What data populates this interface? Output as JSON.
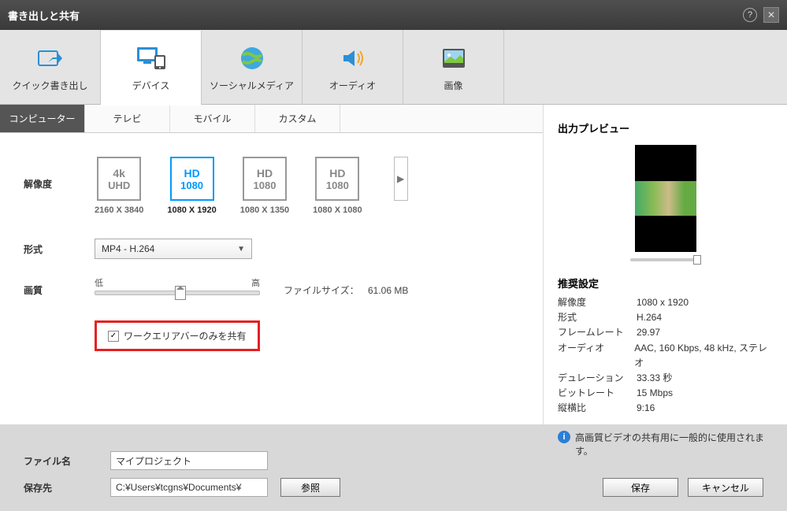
{
  "window": {
    "title": "書き出しと共有"
  },
  "mainTabs": [
    {
      "label": "クイック書き出し"
    },
    {
      "label": "デバイス"
    },
    {
      "label": "ソーシャルメディア"
    },
    {
      "label": "オーディオ"
    },
    {
      "label": "画像"
    }
  ],
  "subTabs": [
    {
      "label": "コンピューター"
    },
    {
      "label": "テレビ"
    },
    {
      "label": "モバイル"
    },
    {
      "label": "カスタム"
    }
  ],
  "labels": {
    "resolution": "解像度",
    "format": "形式",
    "quality": "画質",
    "qualityLow": "低",
    "qualityHigh": "高",
    "filesize": "ファイルサイズ：",
    "checkbox": "ワークエリアバーのみを共有",
    "filename": "ファイル名",
    "savedest": "保存先",
    "browse": "参照",
    "save": "保存",
    "cancel": "キャンセル"
  },
  "resolutions": [
    {
      "top": "4k",
      "bottom": "UHD",
      "caption": "2160 X 3840"
    },
    {
      "top": "HD",
      "bottom": "1080",
      "caption": "1080 X 1920"
    },
    {
      "top": "HD",
      "bottom": "1080",
      "caption": "1080 X 1350"
    },
    {
      "top": "HD",
      "bottom": "1080",
      "caption": "1080 X 1080"
    }
  ],
  "formatValue": "MP4 - H.264",
  "filesizeValue": "61.06 MB",
  "checkboxChecked": true,
  "preview": {
    "title": "出力プレビュー",
    "recTitle": "推奨設定",
    "rows": [
      {
        "k": "解像度",
        "v": "1080 x 1920"
      },
      {
        "k": "形式",
        "v": "H.264"
      },
      {
        "k": "フレームレート",
        "v": "29.97"
      },
      {
        "k": "オーディオ",
        "v": "AAC, 160 Kbps, 48 kHz, ステレオ"
      },
      {
        "k": "デュレーション",
        "v": "33.33 秒"
      },
      {
        "k": "ビットレート",
        "v": "15 Mbps"
      },
      {
        "k": "縦横比",
        "v": "9:16"
      }
    ],
    "info": "高画質ビデオの共有用に一般的に使用されます。"
  },
  "footer": {
    "filename": "マイプロジェクト",
    "savedest": "C:¥Users¥tcgns¥Documents¥"
  }
}
